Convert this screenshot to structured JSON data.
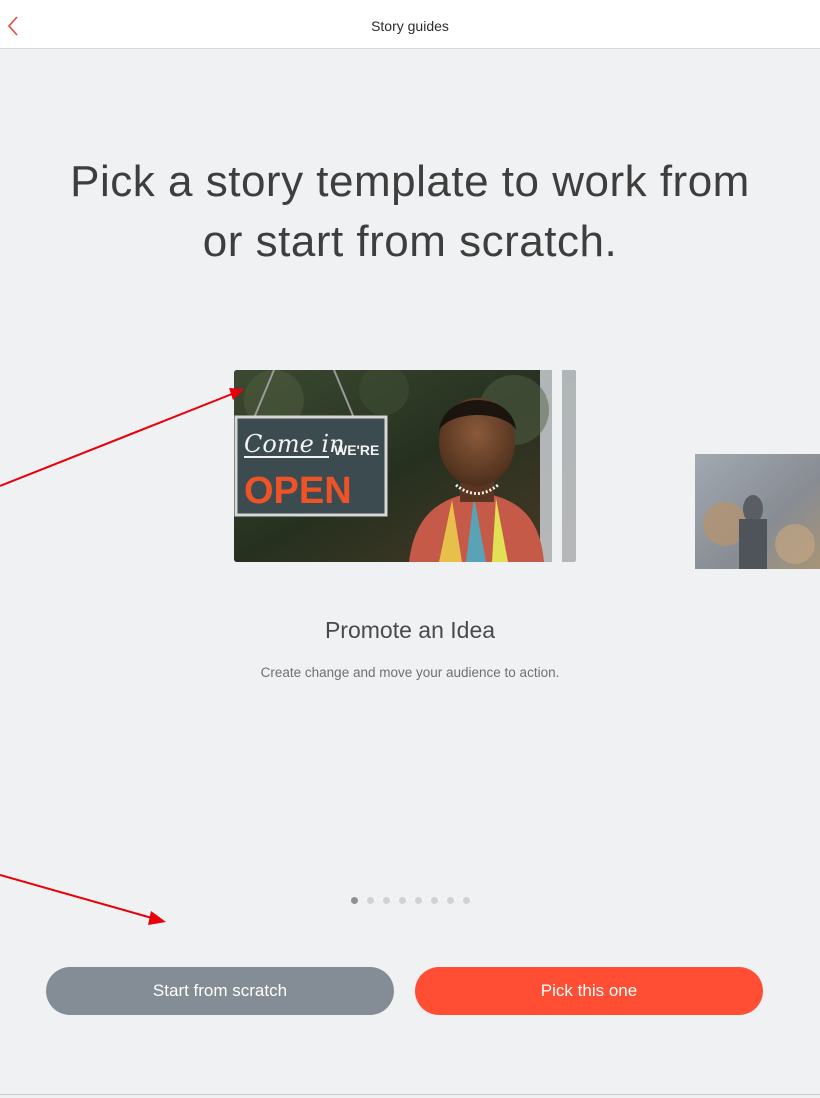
{
  "header": {
    "title": "Story guides",
    "back_icon": "chevron-left-icon",
    "accent": "#e8483b"
  },
  "headline": {
    "line1": "Pick a story template to work from",
    "line2": "or start from scratch."
  },
  "carousel": {
    "current": {
      "name": "Promote an Idea",
      "description": "Create change and move your audience to action.",
      "image": {
        "sign_script": "Come in",
        "sign_small": "WE'RE",
        "sign_big": "OPEN"
      }
    },
    "page_count": 8,
    "active_index": 0
  },
  "buttons": {
    "scratch": "Start from scratch",
    "pick": "Pick this one"
  },
  "colors": {
    "scratch_button": "#848d95",
    "pick_button": "#ff4e33",
    "annotation_arrow": "#e8000b"
  }
}
